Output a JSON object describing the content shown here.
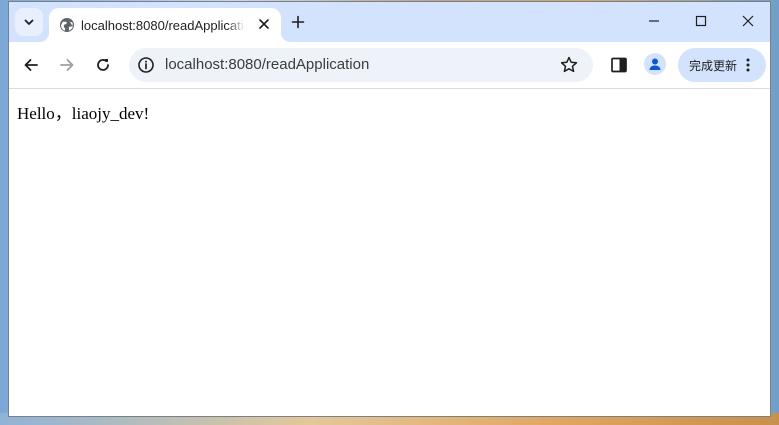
{
  "browser": {
    "tab": {
      "title": "localhost:8080/readApplication",
      "favicon": "globe-icon",
      "close_icon": "close-icon"
    },
    "window_controls": [
      "minimize-icon",
      "maximize-icon",
      "close-icon"
    ],
    "toolbar": {
      "back_icon": "arrow-left-icon",
      "forward_icon": "arrow-right-icon",
      "reload_icon": "reload-icon",
      "url": "localhost:8080/readApplication",
      "site_info_icon": "info-icon",
      "bookmark_icon": "star-icon",
      "side_panel_icon": "side-panel-icon",
      "profile_icon": "person-icon",
      "update_label": "完成更新",
      "menu_icon": "kebab-menu-icon"
    },
    "colors": {
      "titlebar": "#d3e3fd",
      "omnibox": "#eef3fa",
      "update_button": "#d3e3fd",
      "profile_accent": "#0b57d0"
    }
  },
  "page": {
    "greeting": "Hello，liaojy_dev!"
  }
}
